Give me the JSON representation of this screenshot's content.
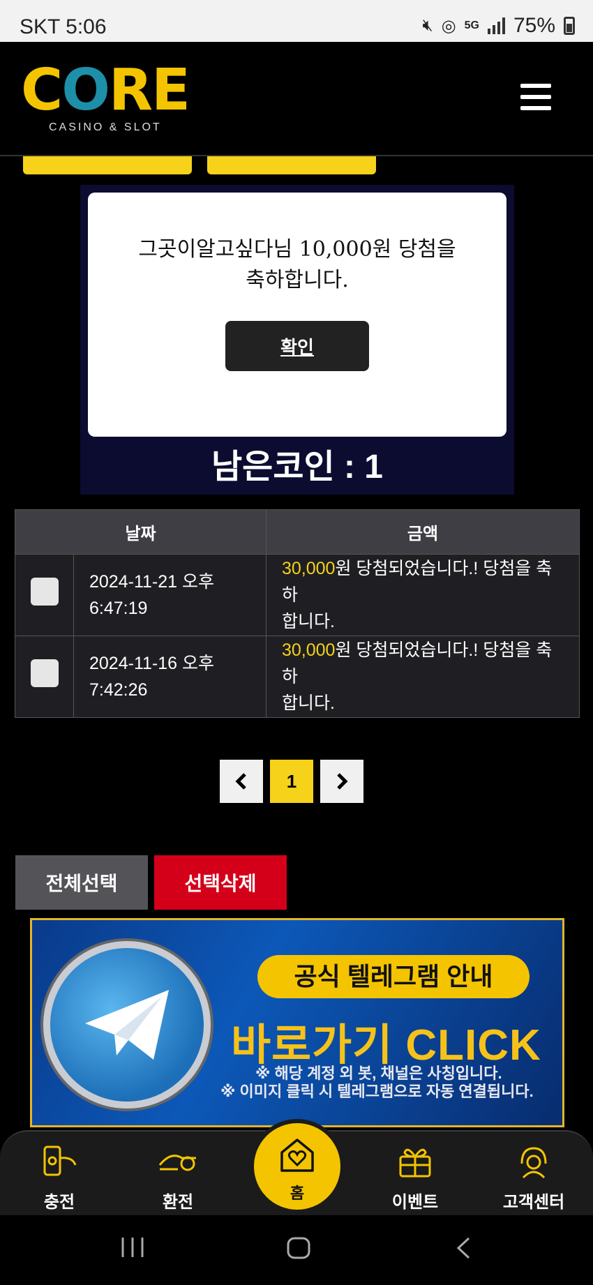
{
  "status_bar": {
    "time": "SKT 5:06",
    "battery": "75%",
    "network": "5G"
  },
  "header": {
    "logo_text": "CORE",
    "logo_sub": "CASINO & SLOT"
  },
  "popup": {
    "message_line1": "그곳이알고싶다님 10,000원 당첨을",
    "message_line2": "축하합니다.",
    "confirm_label": "확인"
  },
  "coins": {
    "label": "남은코인 : 1"
  },
  "table": {
    "headers": [
      "날짜",
      "금액"
    ],
    "rows": [
      {
        "date_line1": "2024-11-21 오후",
        "date_line2": "6:47:19",
        "amount": "30,000",
        "text_line1": "원 당첨되었습니다.! 당첨을 축하",
        "text_line2": "합니다."
      },
      {
        "date_line1": "2024-11-16 오후",
        "date_line2": "7:42:26",
        "amount": "30,000",
        "text_line1": "원 당첨되었습니다.! 당첨을 축하",
        "text_line2": "합니다."
      }
    ]
  },
  "pagination": {
    "current": "1"
  },
  "actions": {
    "select_all": "전체선택",
    "delete_selected": "선택삭제"
  },
  "banner": {
    "pill": "공식 텔레그램 안내",
    "main": "바로가기 CLICK",
    "note1": "※ 해당 계정 외 봇, 채널은 사칭입니다.",
    "note2": "※ 이미지 클릭 시 텔레그램으로 자동 연결됩니다."
  },
  "bottom_nav": {
    "charge": "충전",
    "exchange": "환전",
    "home": "홈",
    "event": "이벤트",
    "support": "고객센터"
  },
  "colors": {
    "accent": "#f6d21a",
    "danger": "#d4001a",
    "panel": "#0c0c30"
  }
}
